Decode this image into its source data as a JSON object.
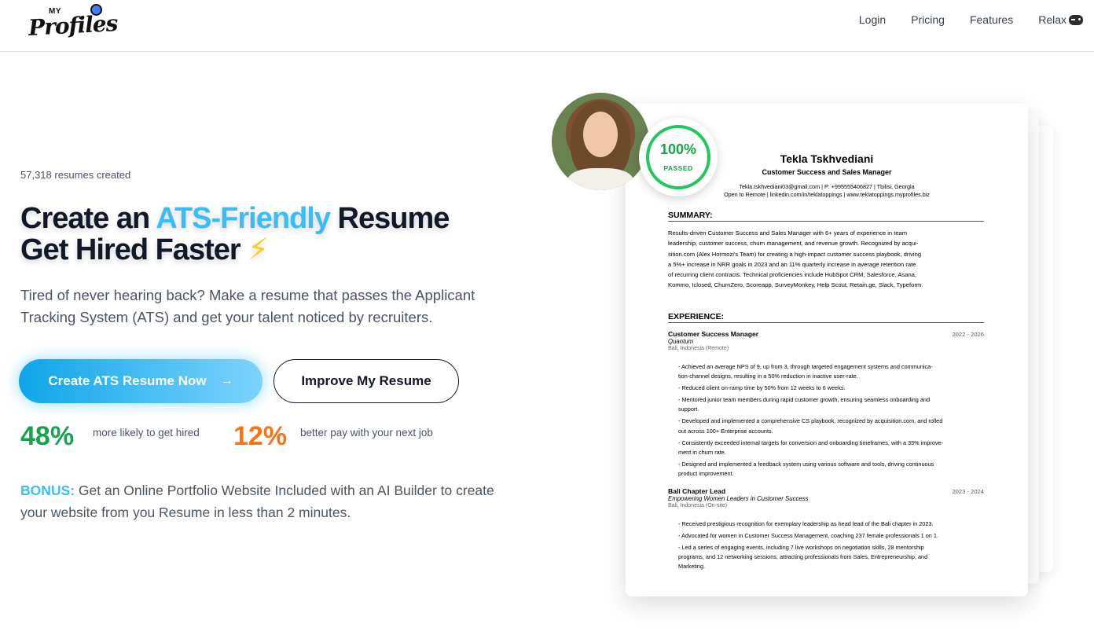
{
  "header": {
    "logo_my": "MY",
    "logo_text": "Profiles",
    "nav": [
      "Login",
      "Pricing",
      "Features",
      "Relax"
    ]
  },
  "hero": {
    "counter": "57,318 resumes created",
    "headline_pre": "Create an ",
    "headline_accent": "ATS-Friendly",
    "headline_post": " Resume",
    "headline_line2": "Get Hired Faster",
    "bolt": "⚡",
    "subtitle": "Tired of never hearing back? Make a resume that passes the Applicant Tracking System (ATS) and get your talent noticed by recruiters.",
    "primary_cta": "Create ATS Resume Now",
    "primary_cta_arrow": "→",
    "secondary_cta": "Improve My Resume",
    "stats": [
      {
        "value": "48%",
        "text": "more likely to get hired",
        "color": "#16a34a"
      },
      {
        "value": "12%",
        "text": "better pay with your next job",
        "color": "#f97316"
      }
    ],
    "bonus_label": "BONUS:",
    "bonus_text": " Get an Online Portfolio Website Included with an AI Builder to create your website from you Resume in less than 2 minutes."
  },
  "badge": {
    "percent": "100%",
    "label": "PASSED"
  },
  "resume": {
    "name": "Tekla Tskhvediani",
    "role": "Customer Success and Sales Manager",
    "contact_line1": "Tekla.tskhvediani03@gmail.com | P: +995555406827 | Tbilisi, Georgia",
    "contact_line2": "Open to Remote | linkedin.com/in/teklatoppings | www.teklatoppings.myprofiles.biz",
    "summary_title": "SUMMARY:",
    "summary_lines": [
      "Results-driven Customer Success and Sales Manager with 6+ years of experience in team",
      "leadership, customer success, churn management, and revenue growth. Recognized by acqui-",
      "sition.com (Alex Hormozi's Team) for creating a high-impact customer success playbook, driving",
      "a 5%+ increase in NRR goals in 2023 and an 11% quarterly increase in average retention rate",
      "of recurring client contracts. Technical proficiencies include HubSpot CRM, Salesforce, Asana,",
      "Kommo, Iclosed, ChurnZero, Scoreapp, SurveyMonkey, Help Scout, Retain.ge, Slack, Typeform."
    ],
    "experience_title": "EXPERIENCE:",
    "jobs": [
      {
        "title": "Customer Success Manager",
        "dates": "2022 - 2026",
        "company": "Quantum",
        "location": "Bali, Indonesia (Remote)",
        "bullets": [
          "- Achieved an average NPS of 9, up from 3, through targeted engagement systems and communica-",
          "tion-channel designs, resulting in a 50% reduction in inactive user-rate.",
          "- Reduced client on-ramp time by 50% from 12 weeks to 6 weeks.",
          "- Mentored junior team members during rapid customer growth, ensuring seamless onboarding and",
          "support.",
          "- Developed and implemented a comprehensive CS playbook, recognized by acquisition.com, and rolled",
          "out across 100+ Enterprise accounts.",
          "- Consistently exceeded internal targets for conversion and onboarding timeframes, with a 35% improve-",
          "ment in churn rate.",
          "- Designed and implemented a feedback system using various software and tools, driving continuous",
          "product improvement."
        ]
      },
      {
        "title": "Bali Chapter Lead",
        "dates": "2023 - 2024",
        "company": "Empowering Women Leaders in Customer Success",
        "location": "Bali, Indonesia (On-site)",
        "bullets": [
          "- Received prestigious recognition for exemplary leadership as head lead of the Bali chapter in 2023.",
          "- Advocated for women in Customer Success Management, coaching 237 female professionals 1 on 1.",
          "- Led a series of engaging events, including 7 live workshops on negotiation skills, 28 mentorship",
          "programs, and 12 networking sessions, attracting professionals from Sales, Entrepreneurship, and",
          "Marketing."
        ]
      }
    ]
  }
}
